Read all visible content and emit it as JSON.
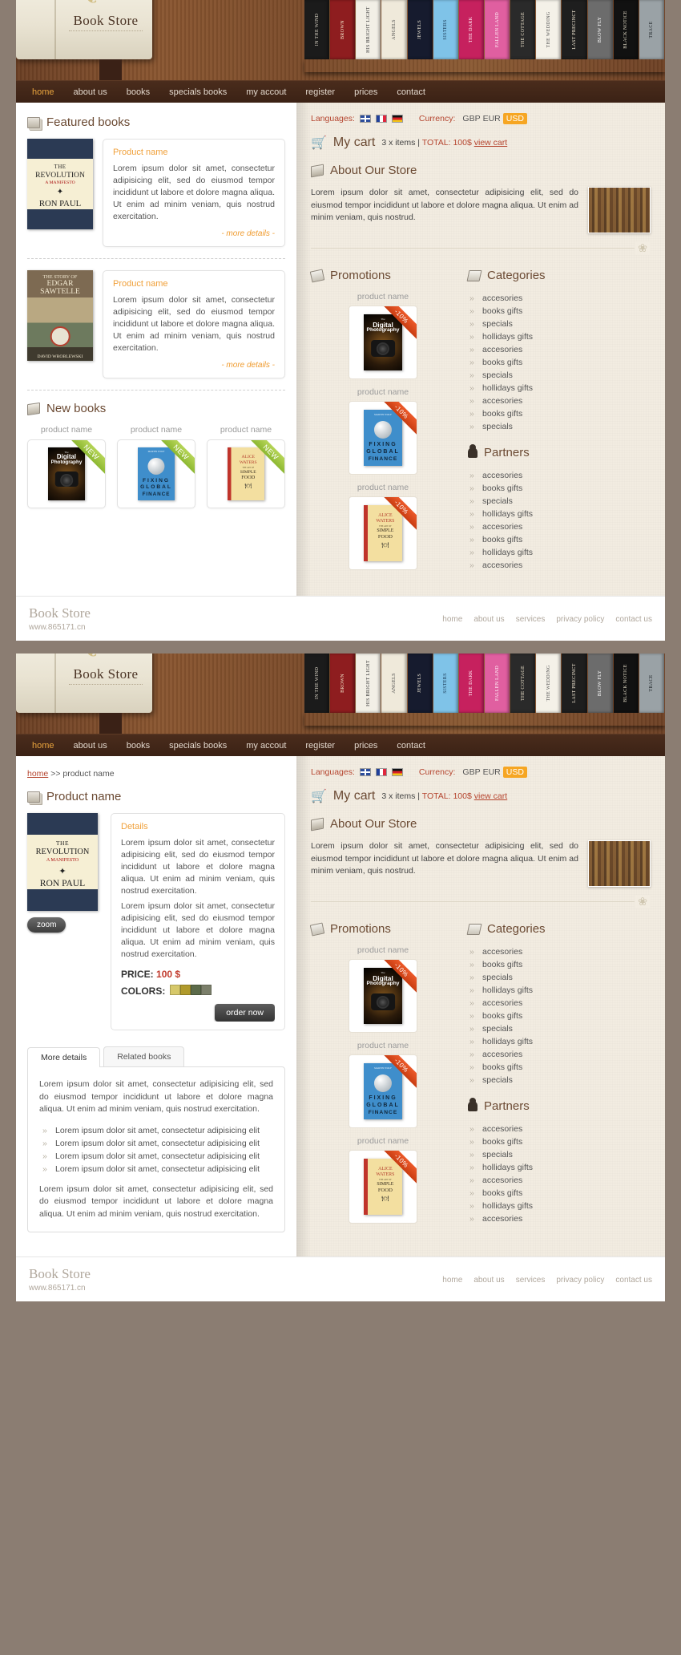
{
  "site": {
    "logo_text": "Book Store",
    "flourish": "❦"
  },
  "nav": {
    "items": [
      {
        "label": "home",
        "active": true
      },
      {
        "label": "about us",
        "active": false
      },
      {
        "label": "books",
        "active": false
      },
      {
        "label": "specials books",
        "active": false
      },
      {
        "label": "my accout",
        "active": false
      },
      {
        "label": "register",
        "active": false
      },
      {
        "label": "prices",
        "active": false
      },
      {
        "label": "contact",
        "active": false
      }
    ]
  },
  "shelf_books": [
    {
      "title": "IN THE WIND",
      "bg": "#1b1b1b",
      "color": "#d8d2c4"
    },
    {
      "title": "BROWN",
      "bg": "#8e1d1f",
      "color": "#f0e2c8"
    },
    {
      "title": "HIS BRIGHT LIGHT",
      "bg": "#f2efe6",
      "color": "#3a3a3a"
    },
    {
      "title": "ANGELS",
      "bg": "#efe9da",
      "color": "#4a4a4a"
    },
    {
      "title": "JEWELS",
      "bg": "#161b2e",
      "color": "#e8e2d0"
    },
    {
      "title": "SISTERS",
      "bg": "#7fc3e8",
      "color": "#1b3a55"
    },
    {
      "title": "THE DARK",
      "bg": "#c6215e",
      "color": "#ffe9f2"
    },
    {
      "title": "FALLEN LAND",
      "bg": "#e05fa0",
      "color": "#fff0f7"
    },
    {
      "title": "THE COTTAGE",
      "bg": "#2a2a2a",
      "color": "#e6dcc6"
    },
    {
      "title": "THE WEDDING",
      "bg": "#f4f1e8",
      "color": "#555"
    },
    {
      "title": "LAST PRECINCT",
      "bg": "#1e1e1e",
      "color": "#f0e6d2"
    },
    {
      "title": "BLOW FLY",
      "bg": "#6c6c6c",
      "color": "#ffffff"
    },
    {
      "title": "BLACK NOTICE",
      "bg": "#111111",
      "color": "#ddd6c2"
    },
    {
      "title": "TRACE",
      "bg": "#9aa2a6",
      "color": "#22282c"
    }
  ],
  "home": {
    "featured": {
      "heading": "Featured books",
      "items": [
        {
          "product_name": "Product name",
          "description": "Lorem ipsum dolor sit amet, consectetur adipisicing elit, sed do eiusmod tempor incididunt ut labore et dolore magna aliqua. Ut enim ad minim veniam, quis nostrud exercitation.",
          "more_label": "- more details -",
          "cover": "revolution"
        },
        {
          "product_name": "Product name",
          "description": "Lorem ipsum dolor sit amet, consectetur adipisicing elit, sed do eiusmod tempor incididunt ut labore et dolore magna aliqua. Ut enim ad minim veniam, quis nostrud exercitation.",
          "more_label": "- more details -",
          "cover": "sawtelle"
        }
      ]
    },
    "new_books": {
      "heading": "New books",
      "badge": "NEW",
      "items": [
        {
          "product_name": "product name",
          "cover": "digital"
        },
        {
          "product_name": "product name",
          "cover": "finance"
        },
        {
          "product_name": "product name",
          "cover": "food"
        }
      ]
    }
  },
  "sidebar": {
    "languages_label": "Languages:",
    "flags": [
      "uk-flag",
      "france-flag",
      "germany-flag"
    ],
    "currency_label": "Currency:",
    "currencies": [
      {
        "code": "GBP",
        "selected": false
      },
      {
        "code": "EUR",
        "selected": false
      },
      {
        "code": "USD",
        "selected": true
      }
    ],
    "cart": {
      "title": "My cart",
      "items_text": "3 x items |",
      "total_text": "TOTAL: 100$",
      "view_label": "view cart"
    },
    "about": {
      "heading": "About Our Store",
      "text": "Lorem ipsum dolor sit amet, consectetur adipisicing elit, sed do eiusmod tempor incididunt ut labore et dolore magna aliqua. Ut enim ad minim veniam, quis nostrud."
    },
    "promotions": {
      "heading": "Promotions",
      "badge": "-10%",
      "items": [
        {
          "product_name": "product name",
          "cover": "digital"
        },
        {
          "product_name": "product name",
          "cover": "finance"
        },
        {
          "product_name": "product name",
          "cover": "food"
        }
      ]
    },
    "categories": {
      "heading": "Categories",
      "items": [
        "accesories",
        "books gifts",
        "specials",
        "hollidays gifts",
        "accesories",
        "books gifts",
        "specials",
        "hollidays gifts",
        "accesories",
        "books gifts",
        "specials"
      ]
    },
    "partners": {
      "heading": "Partners",
      "items": [
        "accesories",
        "books gifts",
        "specials",
        "hollidays gifts",
        "accesories",
        "books gifts",
        "hollidays gifts",
        "accesories"
      ]
    }
  },
  "product_page": {
    "breadcrumb_home": "home",
    "breadcrumb_sep": ">>",
    "breadcrumb_current": "product name",
    "heading": "Product name",
    "zoom_label": "zoom",
    "details": {
      "title": "Details",
      "paragraph1": "Lorem ipsum dolor sit amet, consectetur adipisicing elit, sed do eiusmod tempor incididunt ut labore et dolore magna aliqua. Ut enim ad minim veniam, quis nostrud exercitation.",
      "paragraph2": "Lorem ipsum dolor sit amet, consectetur adipisicing elit, sed do eiusmod tempor incididunt ut labore et dolore magna aliqua. Ut enim ad minim veniam, quis nostrud exercitation."
    },
    "price_label": "PRICE:",
    "price_value": "100 $",
    "colors_label": "COLORS:",
    "color_swatches": [
      "#d6c86a",
      "#b09a2c",
      "#5c6b4a",
      "#7b7f6a"
    ],
    "order_label": "order now",
    "tabs": [
      {
        "label": "More details",
        "active": true
      },
      {
        "label": "Related books",
        "active": false
      }
    ],
    "tab_content": {
      "intro": "Lorem ipsum dolor sit amet, consectetur adipisicing elit, sed do eiusmod tempor incididunt ut labore et dolore magna aliqua. Ut enim ad minim veniam, quis nostrud exercitation.",
      "bullets": [
        "Lorem ipsum dolor sit amet, consectetur adipisicing elit",
        "Lorem ipsum dolor sit amet, consectetur adipisicing elit",
        "Lorem ipsum dolor sit amet, consectetur adipisicing elit",
        "Lorem ipsum dolor sit amet, consectetur adipisicing elit"
      ],
      "outro": "Lorem ipsum dolor sit amet, consectetur adipisicing elit, sed do eiusmod tempor incididunt ut labore et dolore magna aliqua. Ut enim ad minim veniam, quis nostrud exercitation."
    }
  },
  "footer": {
    "logo": "Book Store",
    "url": "www.865171.cn",
    "links": [
      "home",
      "about us",
      "services",
      "privacy policy",
      "contact us"
    ]
  },
  "colors": {
    "accent_orange": "#f0a03a",
    "accent_red": "#b5452f",
    "wood_dark": "#3b2215",
    "sidebar_bg": "#f2ece1"
  }
}
